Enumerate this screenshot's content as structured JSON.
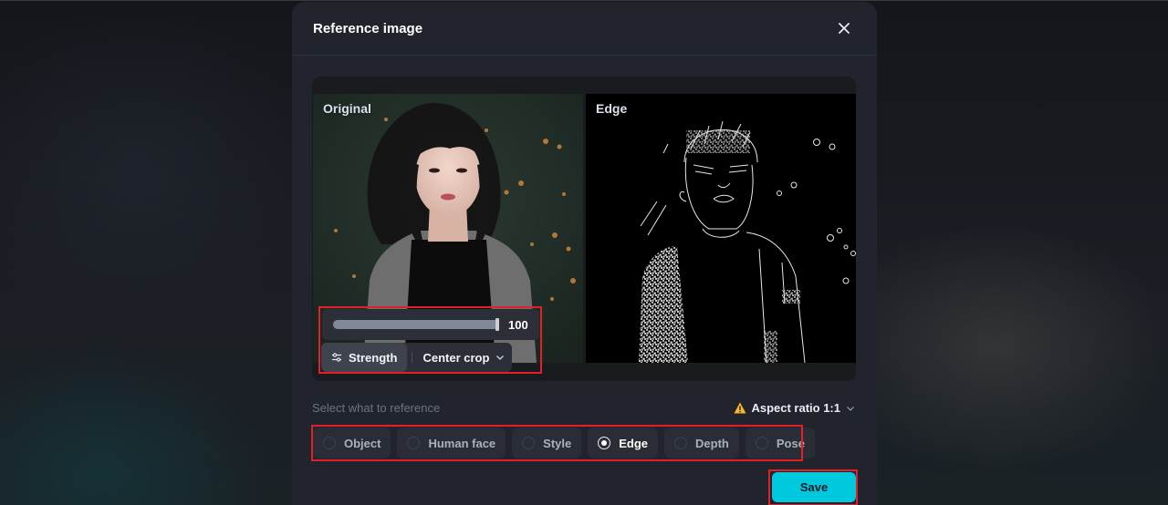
{
  "modal": {
    "title": "Reference image",
    "close_icon": "close-icon"
  },
  "preview": {
    "original_label": "Original",
    "edge_label": "Edge"
  },
  "controls": {
    "strength_value": "100",
    "strength_percent": 100,
    "strength_label": "Strength",
    "crop_label": "Center crop"
  },
  "reference": {
    "label": "Select what to reference",
    "aspect_ratio_label": "Aspect ratio 1:1",
    "options": [
      {
        "label": "Object",
        "selected": false
      },
      {
        "label": "Human face",
        "selected": false
      },
      {
        "label": "Style",
        "selected": false
      },
      {
        "label": "Edge",
        "selected": true
      },
      {
        "label": "Depth",
        "selected": false
      },
      {
        "label": "Pose",
        "selected": false
      }
    ]
  },
  "footer": {
    "save_label": "Save"
  },
  "colors": {
    "accent": "#00c8dd",
    "warning": "#f5b82e",
    "highlight": "#e3202a"
  }
}
